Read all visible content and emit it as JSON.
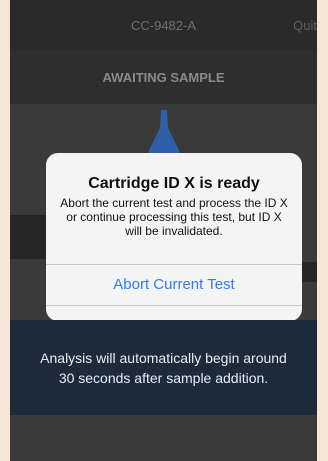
{
  "header": {
    "device_id": "CC-9482-A",
    "quit_label": "Quit",
    "status": "AWAITING SAMPLE"
  },
  "dialog": {
    "title": "Cartridge ID X is ready",
    "message": "Abort the current test and process the ID X or continue processing this test, but ID X will be invalidated.",
    "primary_button": "Abort Current Test"
  },
  "banner": {
    "text": "Analysis will automatically begin around 30 seconds after sample addition."
  },
  "colors": {
    "accent": "#2e7cf6",
    "banner_bg": "#1d2a3a",
    "dropper": "#2f5fa8"
  }
}
